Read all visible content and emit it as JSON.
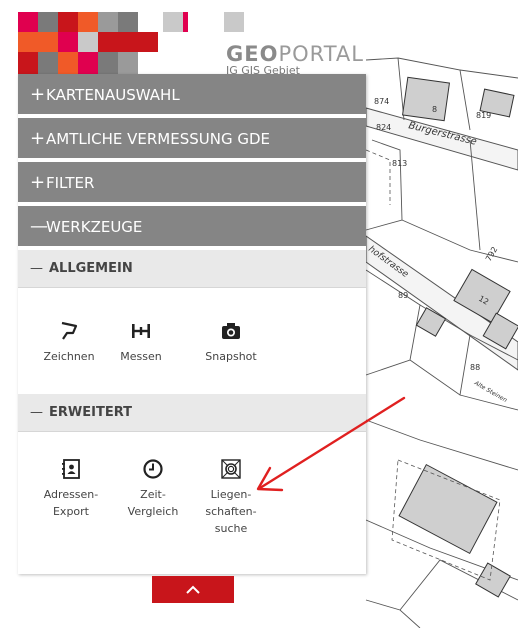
{
  "logo": {
    "title_bold": "GEO",
    "title_light": "PORTAL",
    "subtitle": "IG GIS Gebiet"
  },
  "colors": {
    "brand_red": "#c8151b",
    "header_gray": "#858585",
    "subheader_gray": "#e9e9e9",
    "arrow_red": "#e02020"
  },
  "menu": {
    "sections": [
      {
        "sign": "+",
        "label": "KARTENAUSWAHL"
      },
      {
        "sign": "+",
        "label": "AMTLICHE VERMESSUNG GDE"
      },
      {
        "sign": "+",
        "label": "FILTER"
      },
      {
        "sign": "—",
        "label": "WERKZEUGE"
      }
    ]
  },
  "tools": {
    "general": {
      "sign": "—",
      "title": "ALLGEMEIN",
      "items": [
        {
          "label": "Zeichnen",
          "icon": "draw-polygon-icon"
        },
        {
          "label": "Messen",
          "icon": "measure-icon"
        },
        {
          "label": "Snapshot",
          "icon": "camera-icon"
        }
      ]
    },
    "advanced": {
      "sign": "—",
      "title": "ERWEITERT",
      "items": [
        {
          "label": "Adressen-\nExport",
          "icon": "address-book-icon"
        },
        {
          "label": "Zeit-\nVergleich",
          "icon": "clock-icon"
        },
        {
          "label": "Liegen-\nschaften-\nsuche",
          "icon": "parcel-search-icon"
        }
      ]
    }
  },
  "map": {
    "labels": [
      "874",
      "8",
      "819",
      "824",
      "Burgerstrasse",
      "813",
      "hofstrasse",
      "89",
      "792",
      "12",
      "88",
      "Alte Steinen"
    ]
  },
  "collapse_button": {
    "icon": "chevron-up-icon"
  }
}
